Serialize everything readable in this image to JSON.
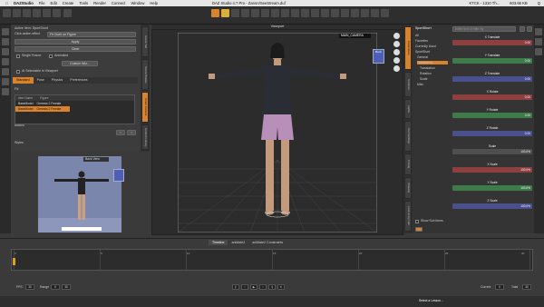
{
  "menubar": {
    "app": "DAZStudio",
    "items": [
      "File",
      "Edit",
      "Create",
      "Tools",
      "Render",
      "Connect",
      "Window",
      "Help"
    ],
    "title": "DAZ Studio 4.7 Pro - Zanon/SeeStream.duf",
    "status_left": "KTCK - 1310 Th...",
    "status_mid": "603.65 KB",
    "status_right": "Q"
  },
  "left_pane": {
    "active_item_label": "Active Item: SportShort",
    "action_label": "Click action effect",
    "action_value": "Fit Cloth on Figure",
    "apply_button": "Apply",
    "clear_button": "Clear",
    "single_frame": "Single Frame",
    "animated": "Animated",
    "custom_button": "Custom Wiz...",
    "checkbox_select": "Al Selectable in Viewport",
    "tabs": [
      "Standard",
      "Pose",
      "Physics",
      "Preferences"
    ],
    "fit_to_label": "Fit:",
    "list_header_col1": "Item Name",
    "list_header_col2": "Figure",
    "list_rows": [
      {
        "name": "BaseModel",
        "figure": "Genesis 2 Female",
        "selected": false
      },
      {
        "name": "BaseModel",
        "figure": "Genesis 2 Female",
        "selected": true
      }
    ],
    "motion_label": "Motion",
    "styles_label": "Styles"
  },
  "left_side_tabs": [
    "Scene Tab",
    "Scene Builder",
    "Smart Content",
    "Content Library"
  ],
  "aux_viewport": {
    "header": "Back View"
  },
  "viewport": {
    "title": "Viewport",
    "camera": "MAIN_CAMERA",
    "cube_label": "Back"
  },
  "right_side_tabs": [
    "Parameters",
    "Surfaces",
    "Lights",
    "Tool Settings",
    "Posing",
    "Shaping",
    "Look at my Hair"
  ],
  "scene": {
    "header": "SportShort",
    "rows": [
      "All",
      "Favorites",
      "Currently Used",
      "SportShort",
      "General",
      "Transforms",
      "Translation",
      "Rotation",
      "Scale",
      "Misc"
    ],
    "selected_row": "Transforms",
    "show_sub_items": "Show Sub Items"
  },
  "parameters": {
    "filter_placeholder": "Enter text or filter by",
    "sliders": [
      {
        "label": "X Translate",
        "value": "0.00",
        "color": "#8e3f3f"
      },
      {
        "label": "Y Translate",
        "value": "0.00",
        "color": "#3e7a4a"
      },
      {
        "label": "Z Translate",
        "value": "0.00",
        "color": "#4a4f8e"
      },
      {
        "label": "X Rotate",
        "value": "0.00",
        "color": "#8e3f3f"
      },
      {
        "label": "Y Rotate",
        "value": "0.00",
        "color": "#3e7a4a"
      },
      {
        "label": "Z Rotate",
        "value": "0.00",
        "color": "#4a4f8e"
      },
      {
        "label": "Scale",
        "value": "100.0%",
        "color": "#4f4f4f"
      },
      {
        "label": "X Scale",
        "value": "100.0%",
        "color": "#8e3f3f"
      },
      {
        "label": "Y Scale",
        "value": "100.0%",
        "color": "#3e7a4a"
      },
      {
        "label": "Z Scale",
        "value": "100.0%",
        "color": "#4a4f8e"
      }
    ]
  },
  "timeline": {
    "tabs": [
      "Timeline",
      "aniMate2",
      "aniMate2 Constraints"
    ],
    "active_tab": "Timeline",
    "ticks": [
      "0",
      "5",
      "10",
      "15",
      "20",
      "25",
      "30"
    ],
    "fps_label": "FPS",
    "fps": "30",
    "range_label": "Range",
    "range_start": "0",
    "range_end": "30",
    "total_label": "Total",
    "total": "30",
    "current_label": "Current",
    "current": "0"
  },
  "lesson": {
    "select_label": "Select a Lesson..."
  },
  "colors": {
    "accent": "#d9822b",
    "viewport_bg": "#2c2c2c",
    "aux_bg": "#7b86ad"
  }
}
